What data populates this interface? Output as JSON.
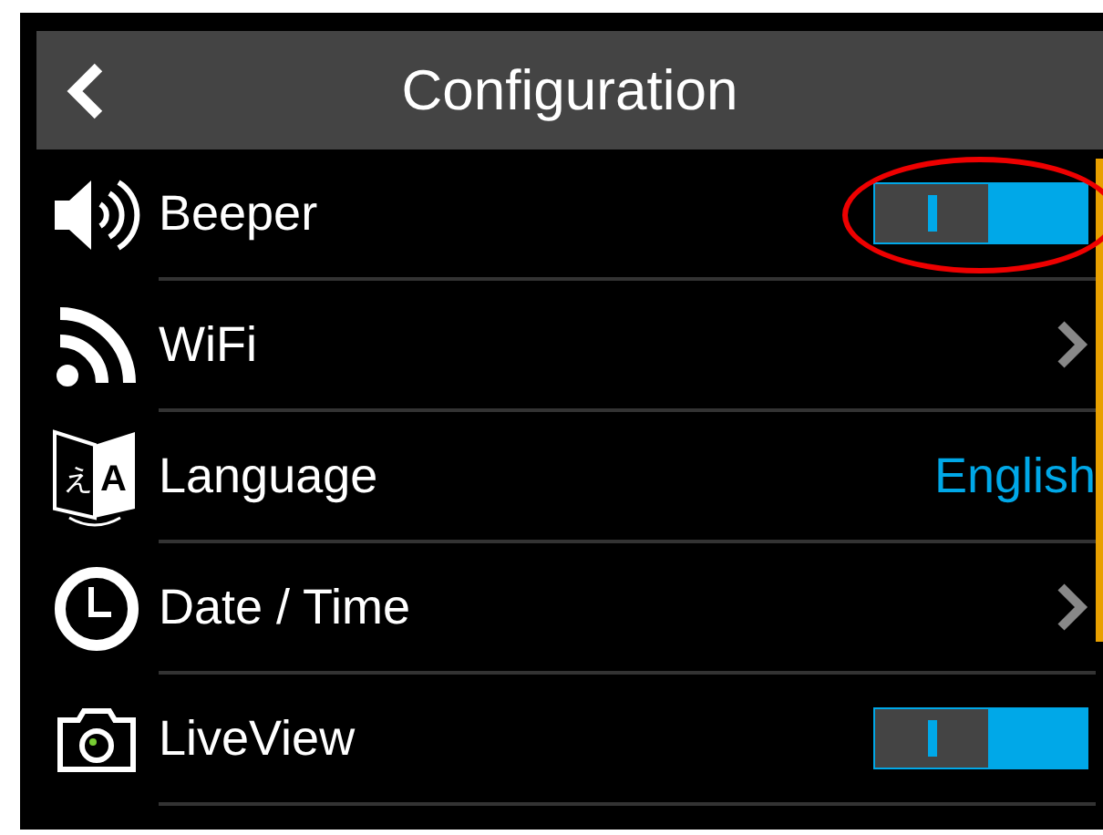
{
  "header": {
    "title": "Configuration"
  },
  "settings": [
    {
      "label": "Beeper",
      "kind": "toggle",
      "on": true,
      "highlighted": true
    },
    {
      "label": "WiFi",
      "kind": "link"
    },
    {
      "label": "Language",
      "kind": "value",
      "value": "English",
      "icon_glyphs": [
        "え",
        "A"
      ]
    },
    {
      "label": "Date / Time",
      "kind": "link"
    },
    {
      "label": "LiveView",
      "kind": "toggle",
      "on": true,
      "highlighted": false
    }
  ]
}
